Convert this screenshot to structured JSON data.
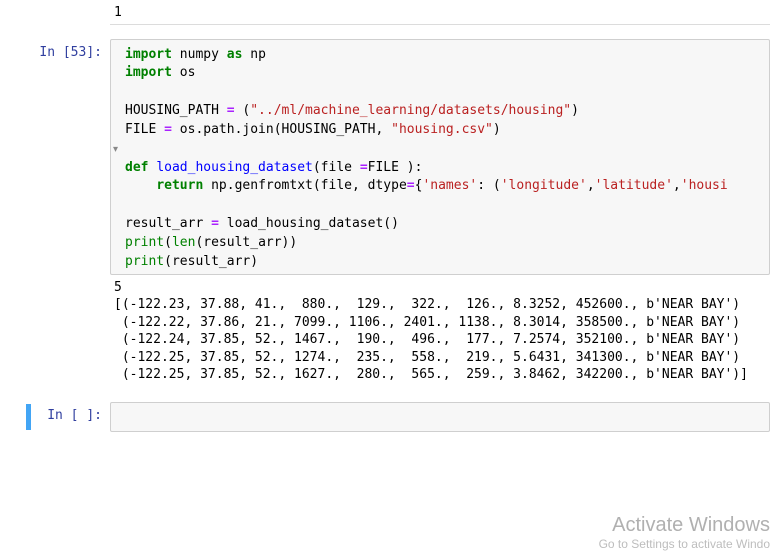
{
  "prev_output": "1",
  "code_cell": {
    "prompt": "In [53]:",
    "code_tokens": [
      {
        "t": "import ",
        "c": "tok-kw"
      },
      {
        "t": "numpy ",
        "c": "tok-name"
      },
      {
        "t": "as ",
        "c": "tok-kw"
      },
      {
        "t": "np",
        "c": "tok-name"
      },
      {
        "t": "\n"
      },
      {
        "t": "import ",
        "c": "tok-kw"
      },
      {
        "t": "os",
        "c": "tok-name"
      },
      {
        "t": "\n\n"
      },
      {
        "t": "HOUSING_PATH ",
        "c": "tok-name"
      },
      {
        "t": "=",
        "c": "tok-op"
      },
      {
        "t": " ("
      },
      {
        "t": "\"../ml/machine_learning/datasets/housing\"",
        "c": "tok-str"
      },
      {
        "t": ")"
      },
      {
        "t": "\n"
      },
      {
        "t": "FILE ",
        "c": "tok-name"
      },
      {
        "t": "=",
        "c": "tok-op"
      },
      {
        "t": " os.path.join(HOUSING_PATH, "
      },
      {
        "t": "\"housing.csv\"",
        "c": "tok-str"
      },
      {
        "t": ")"
      },
      {
        "t": "\n\n"
      },
      {
        "t": "def ",
        "c": "tok-kw"
      },
      {
        "t": "load_housing_dataset",
        "c": "tok-func"
      },
      {
        "t": "(file "
      },
      {
        "t": "=",
        "c": "tok-op"
      },
      {
        "t": "FILE ):"
      },
      {
        "t": "\n    "
      },
      {
        "t": "return ",
        "c": "tok-kw"
      },
      {
        "t": "np.genfromtxt(file, dtype"
      },
      {
        "t": "=",
        "c": "tok-op"
      },
      {
        "t": "{"
      },
      {
        "t": "'names'",
        "c": "tok-str"
      },
      {
        "t": ": ("
      },
      {
        "t": "'longitude'",
        "c": "tok-str"
      },
      {
        "t": ","
      },
      {
        "t": "'latitude'",
        "c": "tok-str"
      },
      {
        "t": ","
      },
      {
        "t": "'housi",
        "c": "tok-str"
      },
      {
        "t": "\n\n"
      },
      {
        "t": "result_arr ",
        "c": "tok-name"
      },
      {
        "t": "=",
        "c": "tok-op"
      },
      {
        "t": " load_housing_dataset()"
      },
      {
        "t": "\n"
      },
      {
        "t": "print",
        "c": "tok-builtin"
      },
      {
        "t": "("
      },
      {
        "t": "len",
        "c": "tok-builtin"
      },
      {
        "t": "(result_arr))"
      },
      {
        "t": "\n"
      },
      {
        "t": "print",
        "c": "tok-builtin"
      },
      {
        "t": "(result_arr)"
      }
    ],
    "output": "5\n[(-122.23, 37.88, 41.,  880.,  129.,  322.,  126., 8.3252, 452600., b'NEAR BAY')\n (-122.22, 37.86, 21., 7099., 1106., 2401., 1138., 8.3014, 358500., b'NEAR BAY')\n (-122.24, 37.85, 52., 1467.,  190.,  496.,  177., 7.2574, 352100., b'NEAR BAY')\n (-122.25, 37.85, 52., 1274.,  235.,  558.,  219., 5.6431, 341300., b'NEAR BAY')\n (-122.25, 37.85, 52., 1627.,  280.,  565.,  259., 3.8462, 342200., b'NEAR BAY')]"
  },
  "empty_cell": {
    "prompt": "In [ ]:"
  },
  "watermark": {
    "line1": "Activate Windows",
    "line2": "Go to Settings to activate Windo"
  },
  "fold_marker": "▾"
}
